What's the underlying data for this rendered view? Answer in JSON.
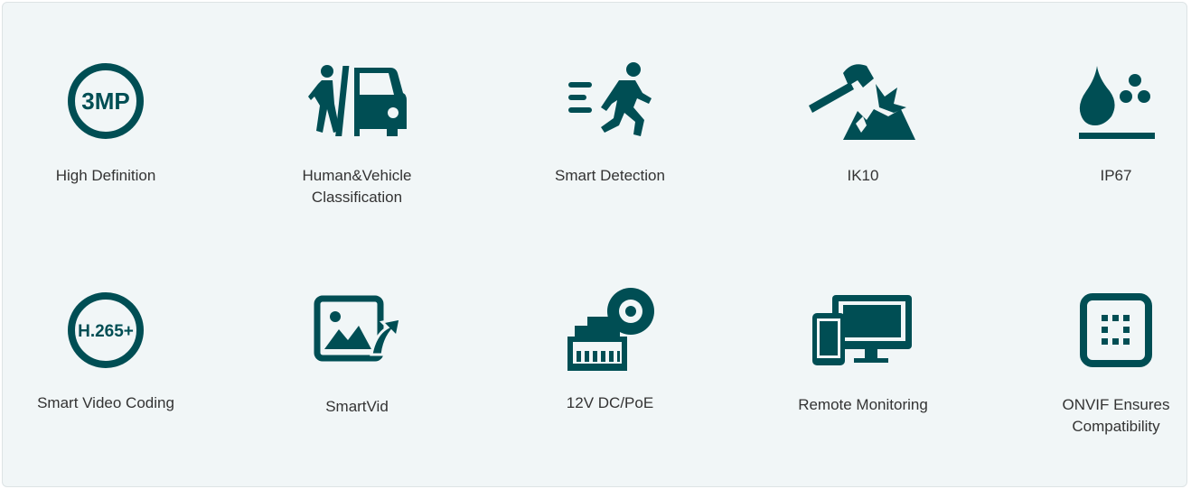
{
  "accent_color": "#004e54",
  "features": [
    {
      "icon": "3mp-icon",
      "label": "High Definition"
    },
    {
      "icon": "human-vehicle-icon",
      "label": "Human&Vehicle\nClassification"
    },
    {
      "icon": "running-person-icon",
      "label": "Smart Detection"
    },
    {
      "icon": "hammer-impact-icon",
      "label": "IK10"
    },
    {
      "icon": "water-dust-icon",
      "label": "IP67"
    },
    {
      "icon": "h265-icon",
      "label": "Smart Video Coding"
    },
    {
      "icon": "image-arrow-icon",
      "label": "SmartVid"
    },
    {
      "icon": "ethernet-port-icon",
      "label": "12V DC/PoE"
    },
    {
      "icon": "monitor-phone-icon",
      "label": "Remote Monitoring"
    },
    {
      "icon": "onvif-chip-icon",
      "label": "ONVIF Ensures\nCompatibility"
    }
  ],
  "icon_text": {
    "resolution": "3MP",
    "codec": "H.265+"
  }
}
